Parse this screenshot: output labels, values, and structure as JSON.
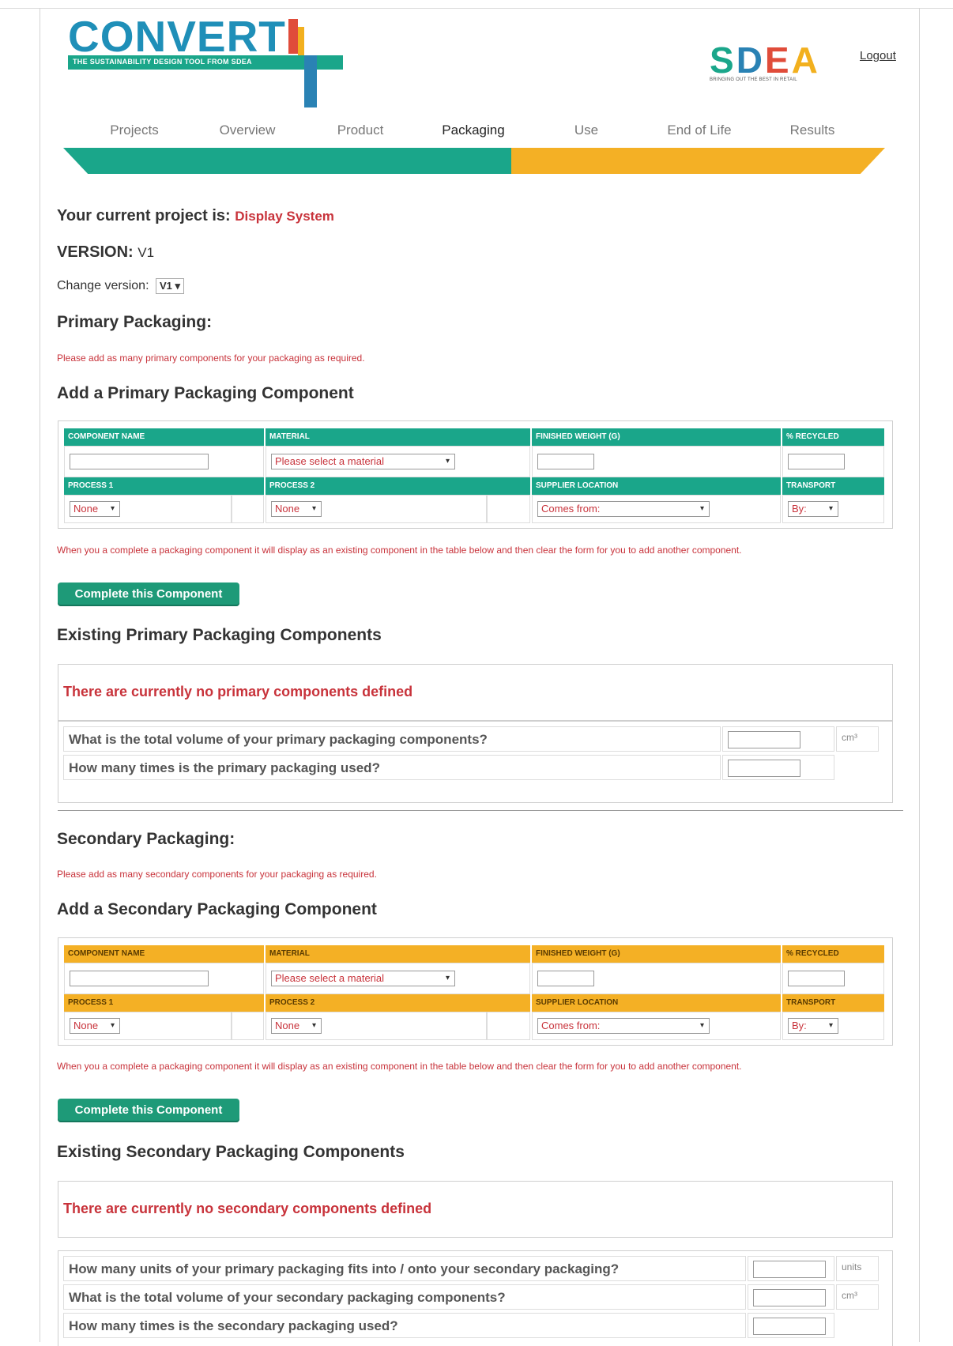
{
  "header": {
    "logo_text": "CONVERT",
    "logo_tagline": "THE SUSTAINABILITY DESIGN TOOL FROM SDEA",
    "sdea_letters": [
      "S",
      "D",
      "E",
      "A"
    ],
    "sdea_tagline": "BRINGING OUT THE BEST IN RETAIL",
    "logout_label": "Logout"
  },
  "nav": {
    "items": [
      {
        "label": "Projects"
      },
      {
        "label": "Overview"
      },
      {
        "label": "Product"
      },
      {
        "label": "Packaging"
      },
      {
        "label": "Use"
      },
      {
        "label": "End of Life"
      },
      {
        "label": "Results"
      }
    ],
    "active": "Packaging"
  },
  "project": {
    "current_label": "Your current project is:",
    "current_value": "Display System",
    "version_label": "VERSION:",
    "version_value": "V1",
    "change_version_label": "Change version:",
    "change_version_selected": "V1"
  },
  "primary": {
    "heading": "Primary Packaging:",
    "note": "Please add as many primary components for your packaging as required.",
    "add_heading": "Add a Primary Packaging Component",
    "existing_heading": "Existing Primary Packaging Components",
    "empty_text": "There are currently no primary components defined",
    "questions": [
      {
        "label": "What is the total volume of your primary packaging components?",
        "unit": "cm³"
      },
      {
        "label": "How many times is the primary packaging used?",
        "unit": ""
      }
    ]
  },
  "secondary": {
    "heading": "Secondary Packaging:",
    "note": "Please add as many secondary components for your packaging as required.",
    "add_heading": "Add a Secondary Packaging Component",
    "existing_heading": "Existing Secondary Packaging Components",
    "empty_text": "There are currently no secondary components defined",
    "questions": [
      {
        "label": "How many units of your primary packaging fits into / onto your secondary packaging?",
        "unit": "units"
      },
      {
        "label": "What is the total volume of your secondary packaging components?",
        "unit": "cm³"
      },
      {
        "label": "How many times is the secondary packaging used?",
        "unit": ""
      }
    ]
  },
  "form": {
    "headers_row1": [
      "COMPONENT NAME",
      "MATERIAL",
      "FINISHED WEIGHT (G)",
      "% RECYCLED"
    ],
    "headers_row2": [
      "PROCESS 1",
      "PROCESS 2",
      "SUPPLIER LOCATION",
      "TRANSPORT"
    ],
    "material_placeholder": "Please select a material",
    "process1_value": "None",
    "process2_value": "None",
    "supplier_value": "Comes from:",
    "transport_value": "By:",
    "complete_note": "When you a complete a packaging component it will display as an existing component in the table below and then clear the form for you to add another component.",
    "complete_button": "Complete this Component"
  },
  "colors": {
    "teal": "#1aa68a",
    "amber": "#f4b025",
    "red_text": "#c8333b",
    "button_green": "#1e9a78"
  }
}
